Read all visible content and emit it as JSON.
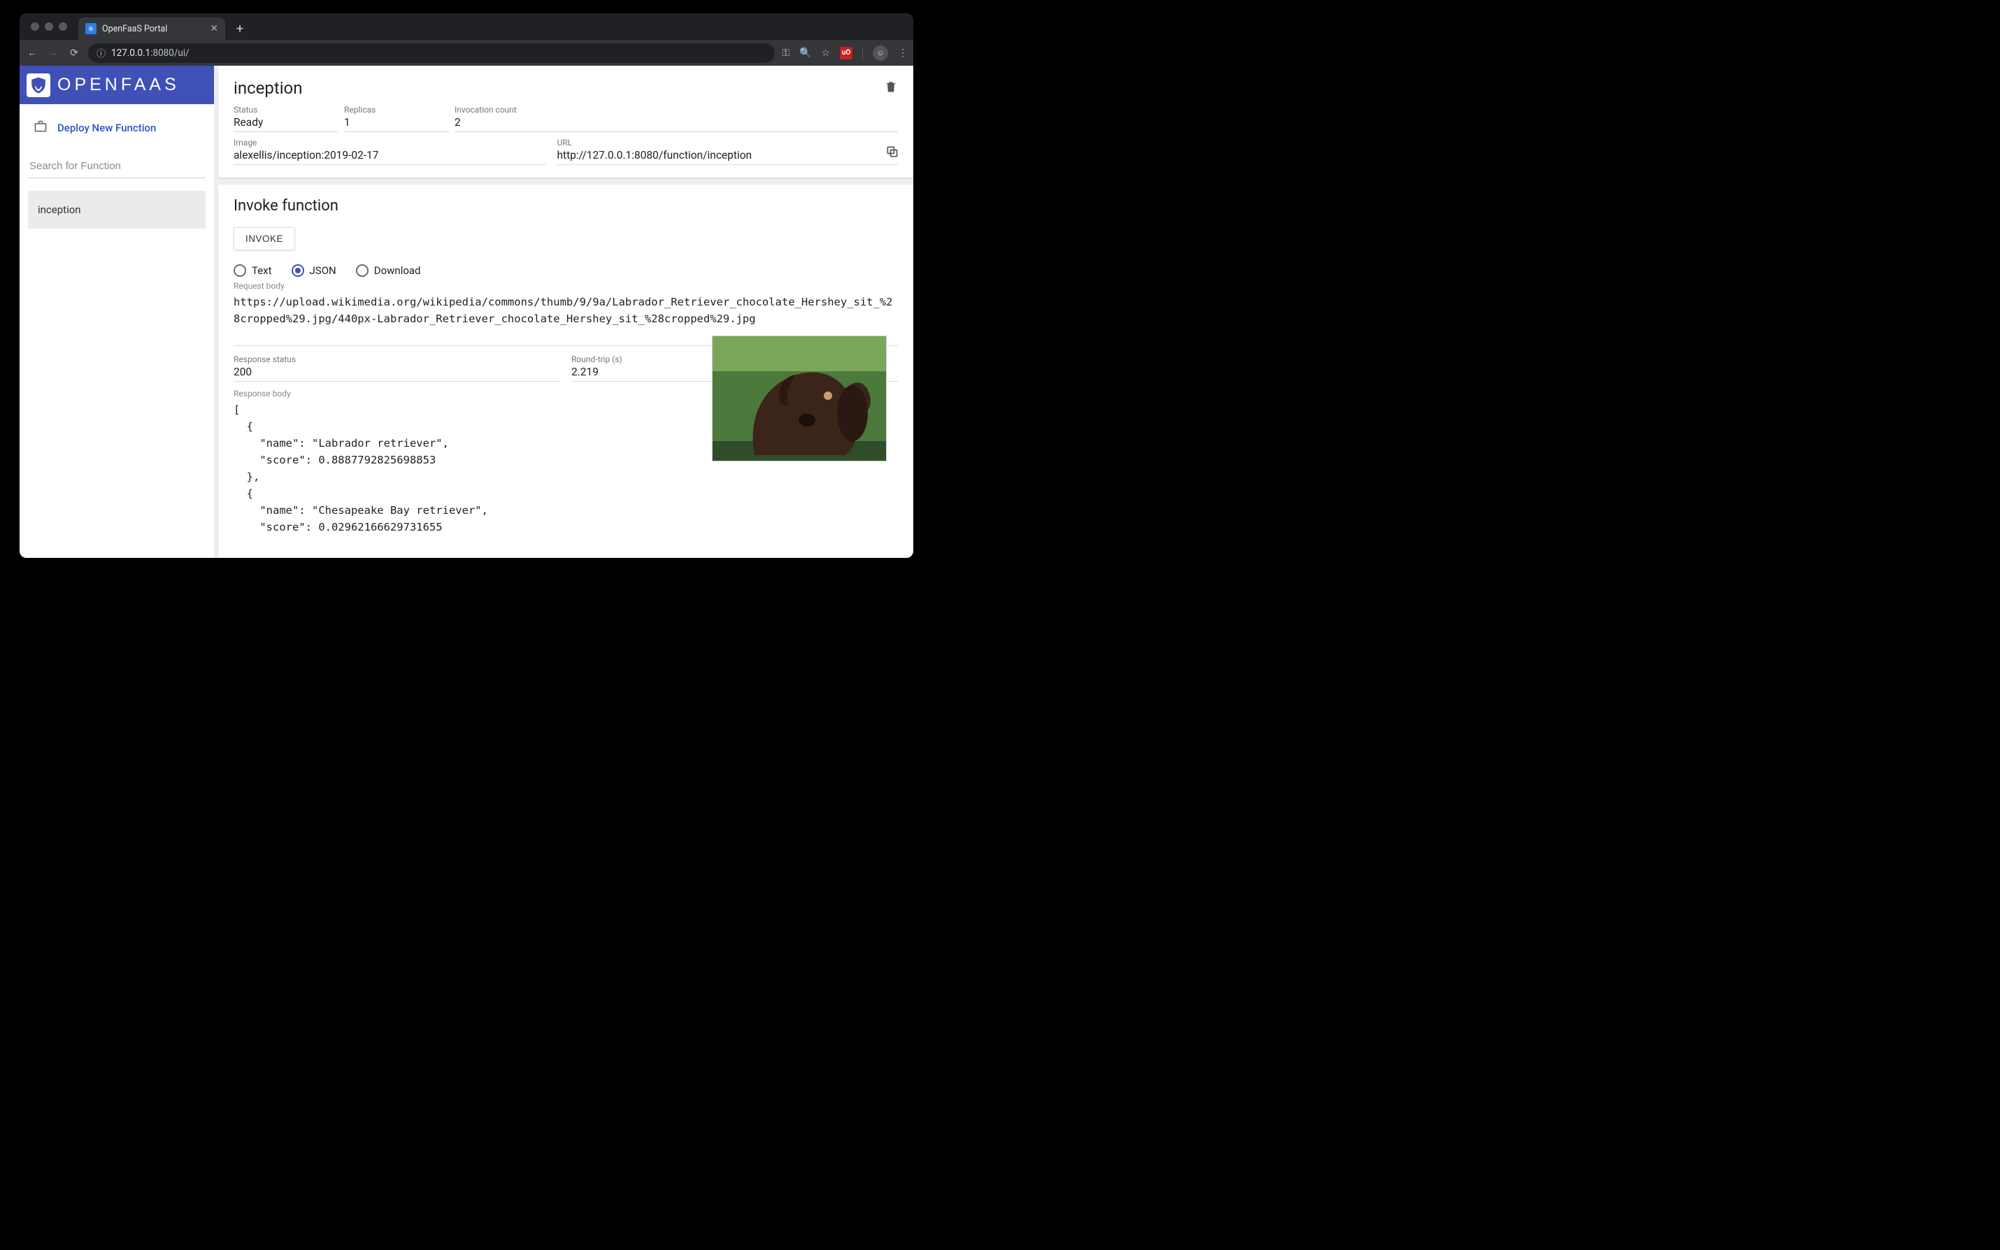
{
  "browser": {
    "tab_title": "OpenFaaS Portal",
    "url_host": "127.0.0.1",
    "url_port_path": ":8080/ui/"
  },
  "brand": {
    "name": "OPENFAAS"
  },
  "sidebar": {
    "deploy_label": "Deploy New Function",
    "search_placeholder": "Search for Function",
    "items": [
      {
        "label": "inception"
      }
    ]
  },
  "fn": {
    "title": "inception",
    "status_label": "Status",
    "status_value": "Ready",
    "replicas_label": "Replicas",
    "replicas_value": "1",
    "invocations_label": "Invocation count",
    "invocations_value": "2",
    "image_label": "Image",
    "image_value": "alexellis/inception:2019-02-17",
    "url_label": "URL",
    "url_value": "http://127.0.0.1:8080/function/inception"
  },
  "invoke": {
    "heading": "Invoke function",
    "button": "INVOKE",
    "radios": {
      "text": "Text",
      "json": "JSON",
      "download": "Download",
      "selected": "json"
    },
    "request_body_label": "Request body",
    "request_body": "https://upload.wikimedia.org/wikipedia/commons/thumb/9/9a/Labrador_Retriever_chocolate_Hershey_sit_%28cropped%29.jpg/440px-Labrador_Retriever_chocolate_Hershey_sit_%28cropped%29.jpg",
    "response_status_label": "Response status",
    "response_status_value": "200",
    "roundtrip_label": "Round-trip (s)",
    "roundtrip_value": "2.219",
    "response_body_label": "Response body",
    "response_body": "[\n  {\n    \"name\": \"Labrador retriever\",\n    \"score\": 0.8887792825698853\n  },\n  {\n    \"name\": \"Chesapeake Bay retriever\",\n    \"score\": 0.02962166629731655"
  }
}
